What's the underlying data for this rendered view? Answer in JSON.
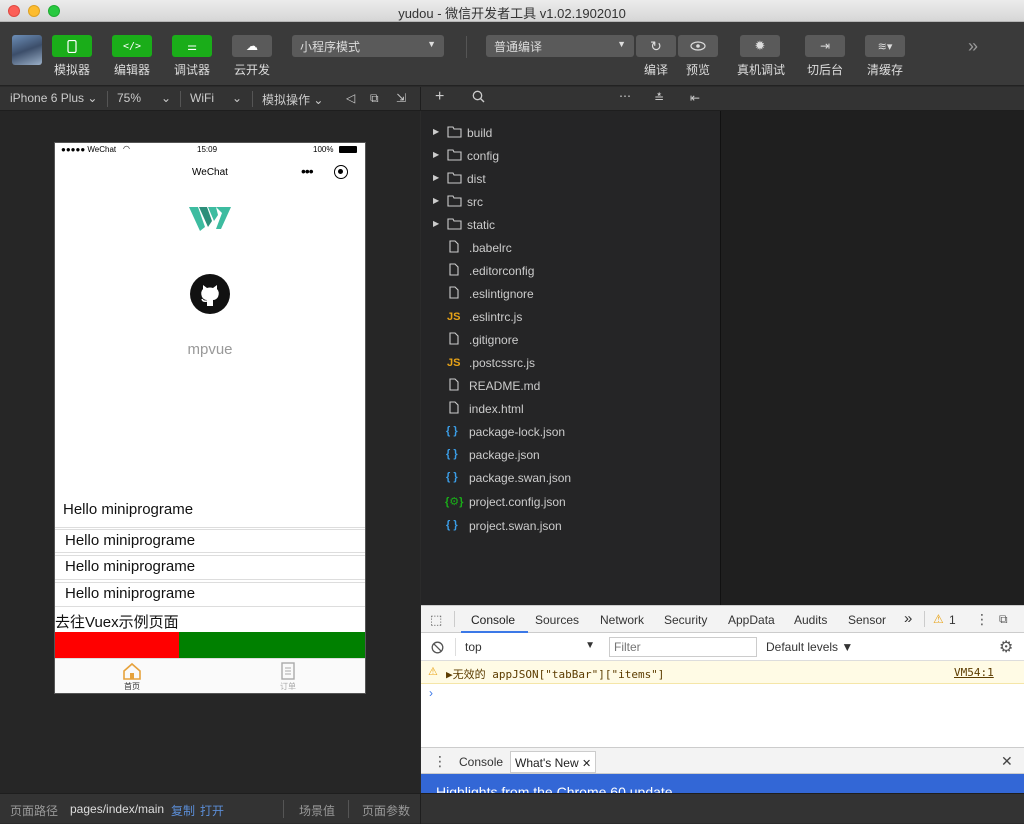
{
  "window": {
    "title": "yudou - 微信开发者工具 v1.02.1902010"
  },
  "toolbar": {
    "simulator_label": "模拟器",
    "editor_label": "编辑器",
    "debugger_label": "调试器",
    "cloud_label": "云开发",
    "mode_select": "小程序模式",
    "compile_select": "普通编译",
    "compile_label": "编译",
    "preview_label": "预览",
    "realdevice_label": "真机调试",
    "background_label": "切后台",
    "clearcache_label": "清缓存"
  },
  "subbar": {
    "device": "iPhone 6 Plus",
    "zoom": "75%",
    "network": "WiFi",
    "simulate": "模拟操作"
  },
  "phone": {
    "carrier": "●●●●● WeChat",
    "time": "15:09",
    "battery": "100%",
    "nav_title": "WeChat",
    "app_name": "mpvue",
    "hello_lines": [
      "Hello miniprograme",
      "Hello miniprograme",
      "Hello miniprograme",
      "Hello miniprograme"
    ],
    "vuex_link": "去往Vuex示例页面",
    "tab_home": "首页",
    "tab_orders": "订单"
  },
  "filetree": {
    "folders": [
      "build",
      "config",
      "dist",
      "src",
      "static"
    ],
    "files": [
      {
        "name": ".babelrc",
        "icon": "file-icon"
      },
      {
        "name": ".editorconfig",
        "icon": "file-icon"
      },
      {
        "name": ".eslintignore",
        "icon": "file-icon"
      },
      {
        "name": ".eslintrc.js",
        "icon": "js-icon"
      },
      {
        "name": ".gitignore",
        "icon": "file-icon"
      },
      {
        "name": ".postcssrc.js",
        "icon": "js-icon"
      },
      {
        "name": "README.md",
        "icon": "file-icon"
      },
      {
        "name": "index.html",
        "icon": "file-icon"
      },
      {
        "name": "package-lock.json",
        "icon": "json-icon"
      },
      {
        "name": "package.json",
        "icon": "json-icon"
      },
      {
        "name": "package.swan.json",
        "icon": "json-icon"
      },
      {
        "name": "project.config.json",
        "icon": "config-icon"
      },
      {
        "name": "project.swan.json",
        "icon": "json-icon"
      }
    ],
    "js_badge": "JS",
    "json_badge": "{ }"
  },
  "devtools": {
    "tabs": [
      "Console",
      "Sources",
      "Network",
      "Security",
      "AppData",
      "Audits",
      "Sensor"
    ],
    "warning_count": "1",
    "context": "top",
    "filter_placeholder": "Filter",
    "levels": "Default levels",
    "warning_message": "▶无效的 appJSON[\"tabBar\"][\"items\"]",
    "warning_source": "VM54:1",
    "drawer_tabs": [
      "Console",
      "What's New"
    ],
    "whatsnew_headline": "Highlights from the Chrome 60 update"
  },
  "statusbar": {
    "path_label": "页面路径",
    "path": "pages/index/main",
    "copy": "复制",
    "open": "打开",
    "scene": "场景值",
    "params": "页面参数"
  },
  "colors": {
    "accent_green": "#1aad19",
    "tab_red": "#ff0000",
    "tab_green": "#008000",
    "whatsnew_blue": "#3367d6"
  }
}
